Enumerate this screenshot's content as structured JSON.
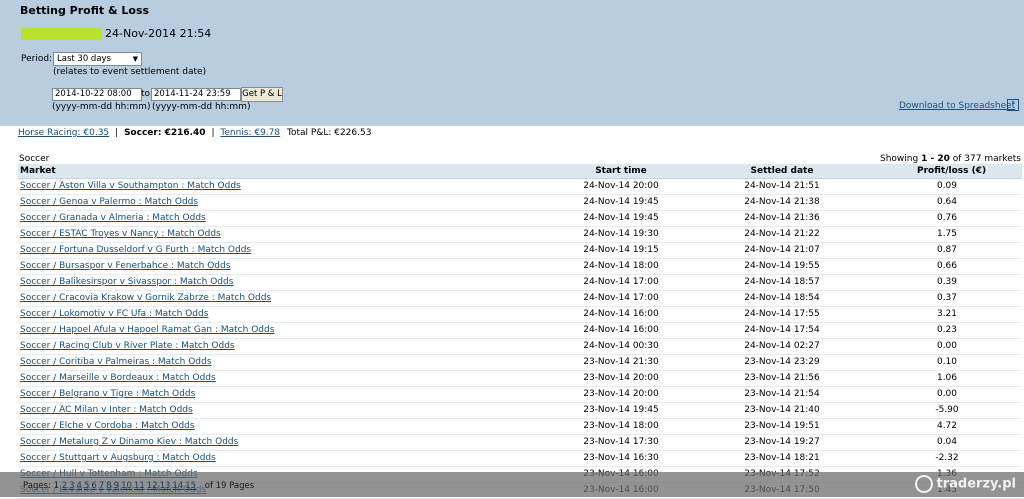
{
  "header": {
    "title": "Betting Profit & Loss",
    "datetime": "24-Nov-2014 21:54",
    "period_label": "Period:",
    "period_value": "Last 30 days",
    "period_note": "(relates to event settlement date)",
    "from_date": "2014-10-22 08:00",
    "to_label": "to",
    "to_date": "2014-11-24 23:59",
    "get_button": "Get P & L",
    "date_format": "(yyyy-mm-dd hh:mm)",
    "download_link": "Download to Spreadsheet",
    "help_icon": "?"
  },
  "summary": {
    "horse_racing": "Horse Racing: €0.35",
    "sep1": "|",
    "soccer": "Soccer: €216.40",
    "sep2": "|",
    "tennis": "Tennis: €9.78",
    "total": "Total P&L: €226.53"
  },
  "section_label": "Soccer",
  "showing": {
    "prefix": "Showing",
    "range": "1 - 20",
    "of": "of",
    "total": "377",
    "suffix": "markets"
  },
  "table": {
    "columns": [
      "Market",
      "Start time",
      "Settled date",
      "Profit/loss (€)"
    ],
    "rows": [
      [
        "Soccer / Aston Villa v Southampton : Match Odds",
        "24-Nov-14 20:00",
        "24-Nov-14 21:51",
        "0.09"
      ],
      [
        "Soccer / Genoa v Palermo : Match Odds",
        "24-Nov-14 19:45",
        "24-Nov-14 21:38",
        "0.64"
      ],
      [
        "Soccer / Granada v Almeria : Match Odds",
        "24-Nov-14 19:45",
        "24-Nov-14 21:36",
        "0.76"
      ],
      [
        "Soccer / ESTAC Troyes v Nancy : Match Odds",
        "24-Nov-14 19:30",
        "24-Nov-14 21:22",
        "1.75"
      ],
      [
        "Soccer / Fortuna Dusseldorf v G Furth : Match Odds",
        "24-Nov-14 19:15",
        "24-Nov-14 21:07",
        "0.87"
      ],
      [
        "Soccer / Bursaspor v Fenerbahce : Match Odds",
        "24-Nov-14 18:00",
        "24-Nov-14 19:55",
        "0.66"
      ],
      [
        "Soccer / Balikesirspor v Sivasspor : Match Odds",
        "24-Nov-14 17:00",
        "24-Nov-14 18:57",
        "0.39"
      ],
      [
        "Soccer / Cracovia Krakow v Gornik Zabrze : Match Odds",
        "24-Nov-14 17:00",
        "24-Nov-14 18:54",
        "0.37"
      ],
      [
        "Soccer / Lokomotiv v FC Ufa : Match Odds",
        "24-Nov-14 16:00",
        "24-Nov-14 17:55",
        "3.21"
      ],
      [
        "Soccer / Hapoel Afula v Hapoel Ramat Gan : Match Odds",
        "24-Nov-14 16:00",
        "24-Nov-14 17:54",
        "0.23"
      ],
      [
        "Soccer / Racing Club v River Plate : Match Odds",
        "24-Nov-14 00:30",
        "24-Nov-14 02:27",
        "0.00"
      ],
      [
        "Soccer / Coritiba v Palmeiras : Match Odds",
        "23-Nov-14 21:30",
        "23-Nov-14 23:29",
        "0.10"
      ],
      [
        "Soccer / Marseille v Bordeaux : Match Odds",
        "23-Nov-14 20:00",
        "23-Nov-14 21:56",
        "1.06"
      ],
      [
        "Soccer / Belgrano v Tigre : Match Odds",
        "23-Nov-14 20:00",
        "23-Nov-14 21:54",
        "0.00"
      ],
      [
        "Soccer / AC Milan v Inter : Match Odds",
        "23-Nov-14 19:45",
        "23-Nov-14 21:40",
        "-5.90"
      ],
      [
        "Soccer / Elche v Cordoba : Match Odds",
        "23-Nov-14 18:00",
        "23-Nov-14 19:51",
        "4.72"
      ],
      [
        "Soccer / Metalurg Z v Dinamo Kiev : Match Odds",
        "23-Nov-14 17:30",
        "23-Nov-14 19:27",
        "0.04"
      ],
      [
        "Soccer / Stuttgart v Augsburg : Match Odds",
        "23-Nov-14 16:30",
        "23-Nov-14 18:21",
        "-2.32"
      ],
      [
        "Soccer / Hull v Tottenham : Match Odds",
        "23-Nov-14 16:00",
        "23-Nov-14 17:52",
        "1.36"
      ],
      [
        "Soccer / Levante v Valencia : Match Odds",
        "23-Nov-14 16:00",
        "23-Nov-14 17:50",
        "1.45"
      ]
    ]
  },
  "pagination": {
    "label": "Pages:",
    "current": "1",
    "pages": [
      "2",
      "3",
      "4",
      "5",
      "6",
      "7",
      "8",
      "9",
      "10",
      "11",
      "12",
      "13",
      "14",
      "15"
    ],
    "of_text": "of 19 Pages"
  },
  "watermark": "traderzy.pl",
  "colors": {
    "header_bg": "#b9cde0",
    "highlight": "#b8e22b",
    "link": "#1a4f7a",
    "table_head_bg": "#dde7ef"
  }
}
